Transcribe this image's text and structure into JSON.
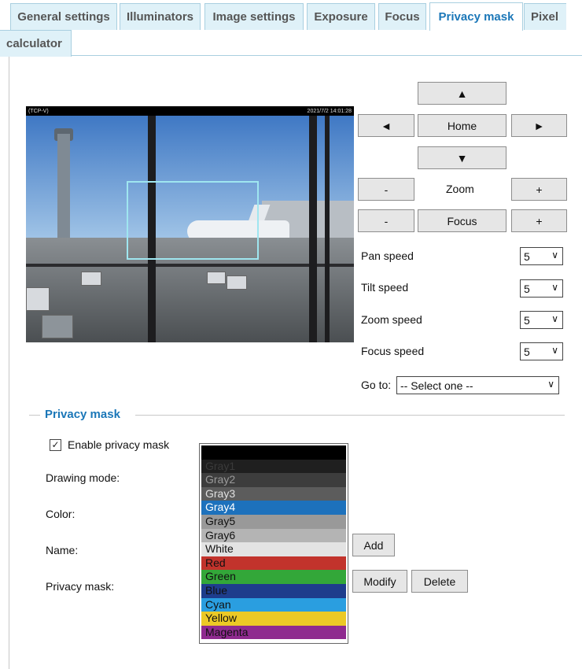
{
  "tabs": [
    {
      "label": "General settings"
    },
    {
      "label": "Illuminators"
    },
    {
      "label": "Image settings"
    },
    {
      "label": "Exposure"
    },
    {
      "label": "Focus"
    },
    {
      "label": "Privacy mask"
    },
    {
      "label": "Pixel calculator"
    }
  ],
  "video": {
    "camera_label": "(TCP-V)",
    "timestamp": "2021/7/2 14:01:28"
  },
  "ptz": {
    "up": "▲",
    "down": "▼",
    "left": "◄",
    "right": "►",
    "home": "Home",
    "zoom_minus": "-",
    "zoom_label": "Zoom",
    "zoom_plus": "+",
    "focus_minus": "-",
    "focus_label": "Focus",
    "focus_plus": "+",
    "pan_speed_label": "Pan speed",
    "pan_speed": "5",
    "tilt_speed_label": "Tilt speed",
    "tilt_speed": "5",
    "zoom_speed_label": "Zoom speed",
    "zoom_speed": "5",
    "focus_speed_label": "Focus speed",
    "focus_speed": "5",
    "goto_label": "Go to:",
    "goto_value": "-- Select one --"
  },
  "privacy": {
    "title": "Privacy mask",
    "enable_label": "Enable privacy mask",
    "enable_checked": "✓",
    "drawing_mode_label": "Drawing mode:",
    "color_label": "Color:",
    "name_label": "Name:",
    "privacy_mask_label": "Privacy mask:",
    "add_label": "Add",
    "modify_label": "Modify",
    "delete_label": "Delete"
  },
  "color_options": [
    {
      "label": "",
      "bg": "#000000",
      "fg": "#000000"
    },
    {
      "label": "Gray1",
      "bg": "#1f1f1f",
      "fg": "#3a3a3a"
    },
    {
      "label": "Gray2",
      "bg": "#3d3d3d",
      "fg": "#9a9a9a"
    },
    {
      "label": "Gray3",
      "bg": "#5c5c5c",
      "fg": "#e0e0e0"
    },
    {
      "label": "Gray4",
      "bg": "#1d71bc",
      "fg": "#ffffff"
    },
    {
      "label": "Gray5",
      "bg": "#999999",
      "fg": "#111111"
    },
    {
      "label": "Gray6",
      "bg": "#b4b4b4",
      "fg": "#111111"
    },
    {
      "label": "White",
      "bg": "#e3e3e3",
      "fg": "#111111"
    },
    {
      "label": "Red",
      "bg": "#c2332c",
      "fg": "#111111"
    },
    {
      "label": "Green",
      "bg": "#33a739",
      "fg": "#111111"
    },
    {
      "label": "Blue",
      "bg": "#1e3d8c",
      "fg": "#111111"
    },
    {
      "label": "Cyan",
      "bg": "#2a9ee0",
      "fg": "#111111"
    },
    {
      "label": "Yellow",
      "bg": "#ecc926",
      "fg": "#111111"
    },
    {
      "label": "Magenta",
      "bg": "#8f2a8f",
      "fg": "#111111"
    }
  ],
  "colors": {
    "accent": "#1b77b8",
    "tab_bg": "#dff1f8"
  }
}
